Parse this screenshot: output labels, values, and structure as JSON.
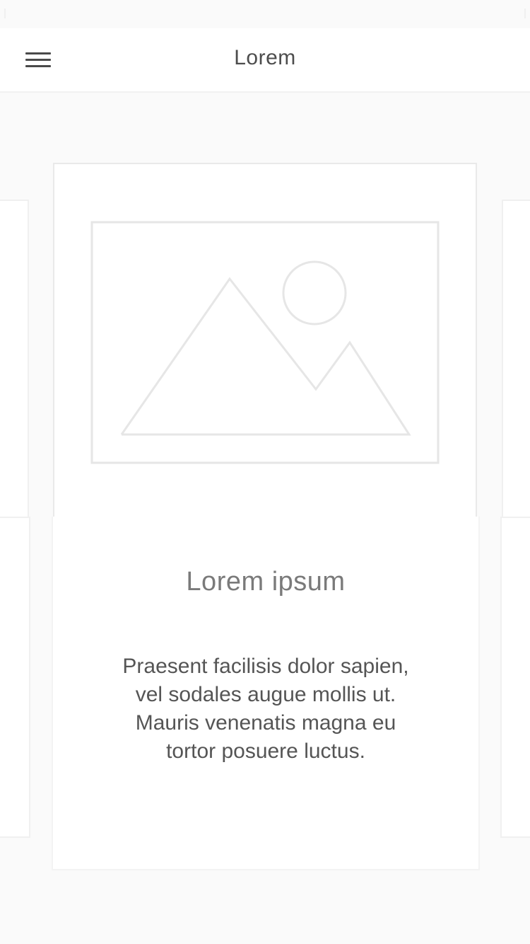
{
  "header": {
    "title": "Lorem",
    "menu_icon": "hamburger-menu-icon"
  },
  "carousel": {
    "card": {
      "image_icon": "image-placeholder-icon",
      "title": "Lorem ipsum",
      "description_lines": [
        "Praesent facilisis dolor sapien,",
        "vel sodales augue mollis ut.",
        "Mauris venenatis magna eu",
        "tortor posuere luctus."
      ]
    }
  },
  "colors": {
    "background": "#fafafa",
    "card": "#ffffff",
    "border": "#e9e9e9",
    "title": "#7a7a7a",
    "text": "#555555"
  }
}
